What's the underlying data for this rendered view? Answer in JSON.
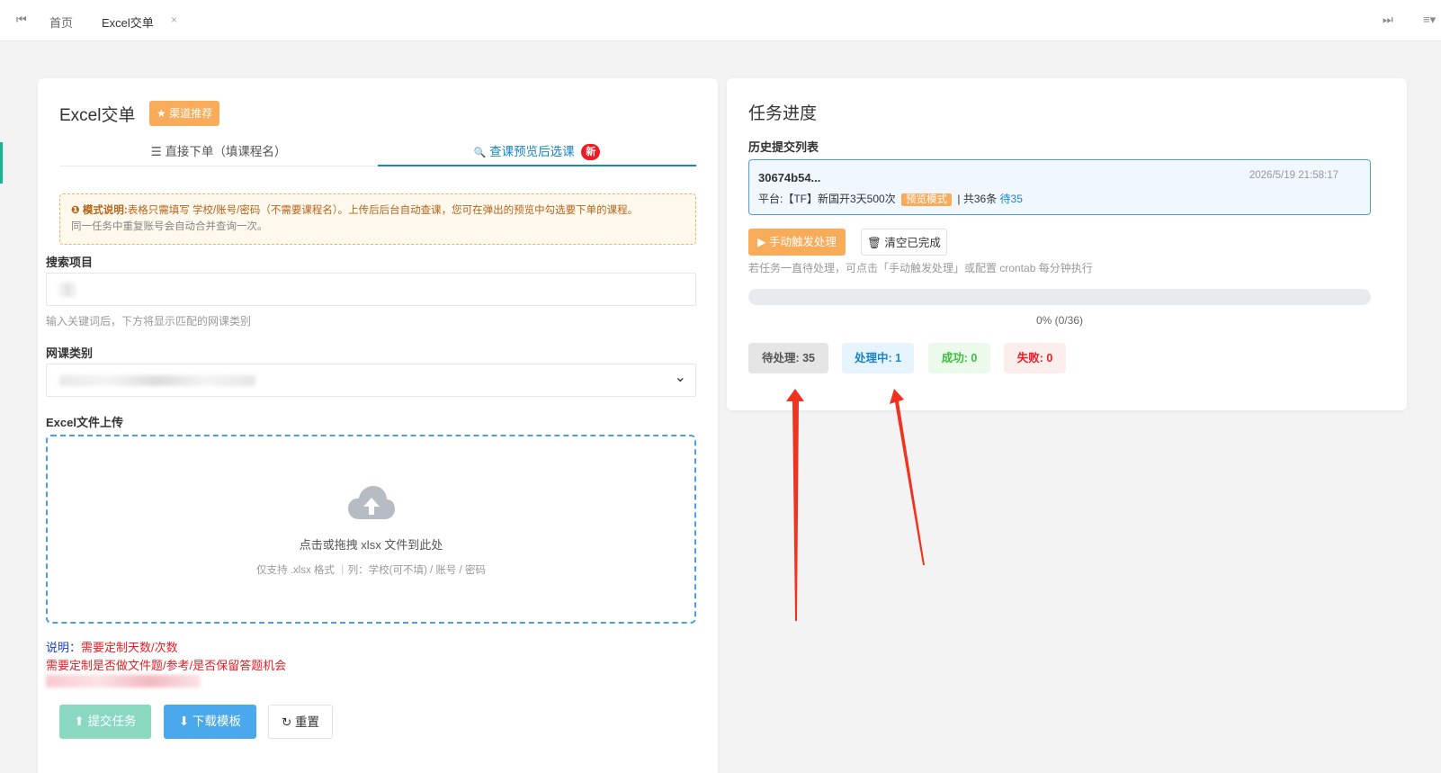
{
  "topbar": {
    "first_icon": "⏮",
    "tabs": [
      {
        "label": "首页"
      },
      {
        "label": "Excel交单",
        "close": "×"
      }
    ],
    "last_icon": "⏭",
    "menu_icon": "≡▾"
  },
  "left": {
    "title": "Excel交单",
    "recommend_button": "★ 渠道推荐",
    "tabs": [
      {
        "icon": "☰",
        "label": "直接下单（填课程名）"
      },
      {
        "icon": "🔍",
        "label": "查课预览后选课",
        "badge": "新"
      }
    ],
    "notice": {
      "prefix": "❶ 模式说明:",
      "text": "表格只需填写 学校/账号/密码（不需要课程名）。上传后后台自动查课，您可在弹出的预览中勾选要下单的课程。",
      "sub": "同一任务中重复账号会自动合并查询一次。"
    },
    "search": {
      "label": "搜索项目",
      "help": "输入关键词后，下方将显示匹配的网课类别"
    },
    "category": {
      "label": "网课类别",
      "chevron": "⌄"
    },
    "upload": {
      "label": "Excel文件上传",
      "main_text": "点击或拖拽 xlsx 文件到此处",
      "sub_text": "仅支持 .xlsx 格式 ｜列：学校(可不填) / 账号 / 密码"
    },
    "notes": {
      "prefix": "说明：",
      "line1": "需要定制天数/次数",
      "line2": "需要定制是否做文件题/参考/是否保留答题机会"
    },
    "buttons": {
      "submit": "⬆ 提交任务",
      "download": "⬇ 下载模板",
      "reset": "↻ 重置"
    }
  },
  "right": {
    "title": "任务进度",
    "history_label": "历史提交列表",
    "history": {
      "id": "30674b54...",
      "time": "2026/5/19 21:58:17",
      "platform": "平台:【TF】新国开3天500次",
      "mode_badge": "预览模式",
      "total": "| 共36条",
      "pending_link": "待35"
    },
    "trigger_button": "▶ 手动触发处理",
    "clear_button": "🗑 清空已完成",
    "hint": "若任务一直待处理，可点击「手动触发处理」或配置 crontab 每分钟执行",
    "progress": {
      "value": 0,
      "text": "0% (0/36)"
    },
    "stats": {
      "pending": "待处理: 35",
      "processing": "处理中: 1",
      "success": "成功: 0",
      "fail": "失败: 0"
    }
  },
  "colors": {
    "primary": "#1c84c6",
    "orange": "#f8ac59",
    "green": "#1ab394",
    "red": "#ed1c24",
    "arrow": "#f0321e"
  }
}
